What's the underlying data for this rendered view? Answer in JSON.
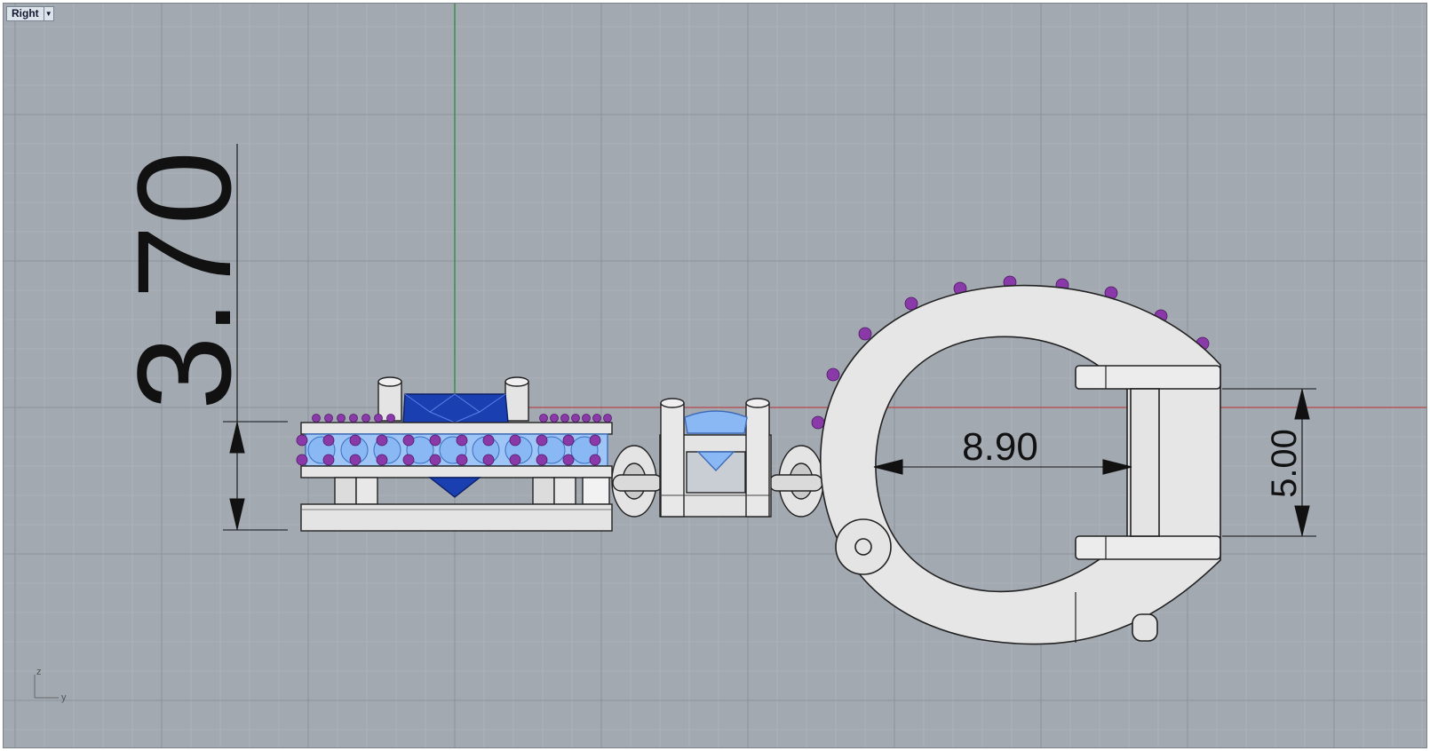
{
  "viewport": {
    "name": "Right",
    "menu_icon": "chevron-down-icon",
    "background_color": "#a3a9b1",
    "grid_minor_color": "#b0b5bc",
    "grid_major_color": "#8e949c"
  },
  "dimensions": {
    "height_total": "3.70",
    "inner_width": "8.90",
    "bail_opening": "5.00"
  },
  "axis_widget": {
    "z_label": "z",
    "y_label": "y"
  },
  "colors": {
    "metal": "#e4e4e4",
    "main_gem": "#1a3fb0",
    "small_gems": "#8ab8f5",
    "accent_gems": "#8a3aa8",
    "y_axis": "#2f8a3a",
    "x_axis": "#b5474a"
  }
}
